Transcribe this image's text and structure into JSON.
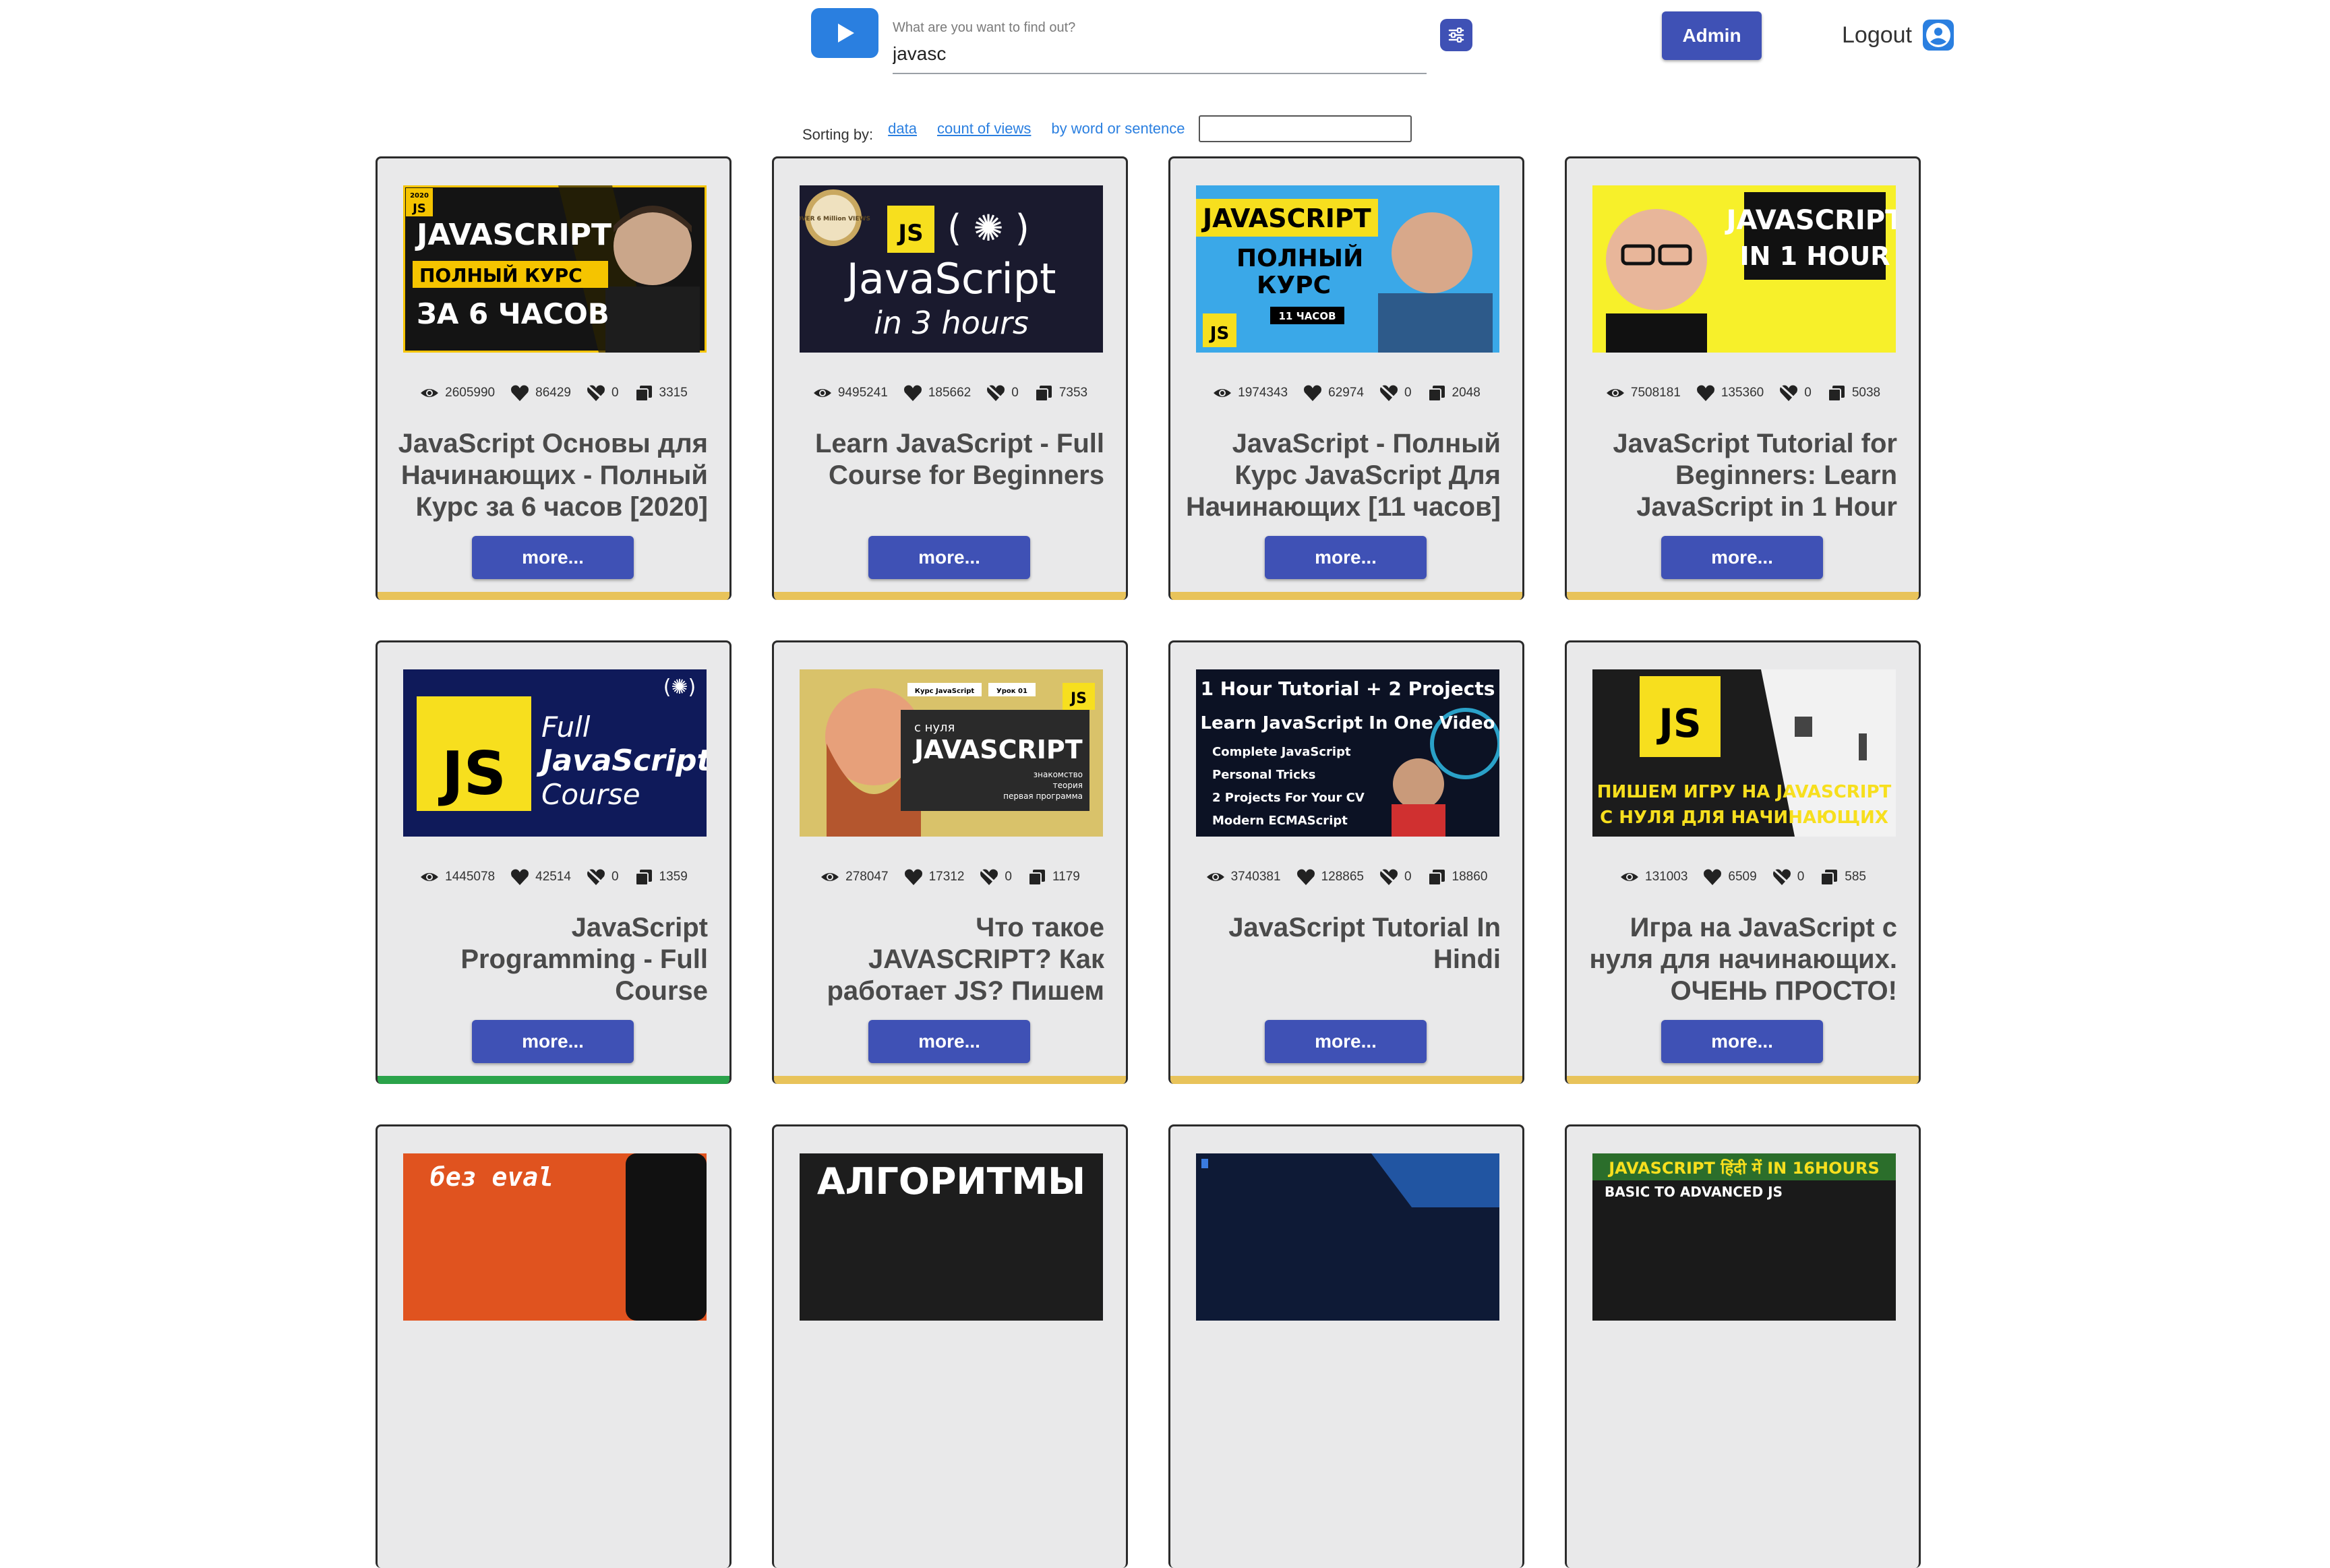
{
  "header": {
    "search_label": "What are you want to find out?",
    "search_value": "javasc",
    "admin_label": "Admin",
    "logout_label": "Logout"
  },
  "sorting": {
    "label": "Sorting by:",
    "options": [
      "data",
      "count of views",
      "by word or sentence"
    ],
    "word_input_value": ""
  },
  "colors": {
    "accent": "#3f51b5",
    "logo": "#2a7fe0",
    "bar_yellow": "#e8c35a",
    "bar_green": "#2aa34a"
  },
  "cards": [
    {
      "title": "JavaScript Основы для Начинающих - Полный Курс за 6 часов [2020]",
      "views": "2605990",
      "likes": "86429",
      "dislikes": "0",
      "comments": "3315",
      "more": "more...",
      "bar": "yellow",
      "thumb": {
        "lines": [
          "JAVASCRIPT",
          "ПОЛНЫЙ КУРС",
          "ЗА 6 ЧАСОВ"
        ],
        "badge": "JS",
        "year": "2020"
      }
    },
    {
      "title": "Learn JavaScript - Full Course for Beginners",
      "views": "9495241",
      "likes": "185662",
      "dislikes": "0",
      "comments": "7353",
      "more": "more...",
      "bar": "yellow",
      "thumb": {
        "lines": [
          "JavaScript",
          "in 3 hours"
        ],
        "badge": "JS",
        "seal": "OVER 6 Million VIEWS"
      }
    },
    {
      "title": "JavaScript - Полный Курс JavaScript Для Начинающих [11 часов]",
      "views": "1974343",
      "likes": "62974",
      "dislikes": "0",
      "comments": "2048",
      "more": "more...",
      "bar": "yellow",
      "thumb": {
        "lines": [
          "JAVASCRIPT",
          "ПОЛНЫЙ",
          "КУРС",
          "11 ЧАСОВ"
        ],
        "badge": "JS"
      }
    },
    {
      "title": "JavaScript Tutorial for Beginners: Learn JavaScript in 1 Hour",
      "views": "7508181",
      "likes": "135360",
      "dislikes": "0",
      "comments": "5038",
      "more": "more...",
      "bar": "yellow",
      "thumb": {
        "lines": [
          "JAVASCRIPT",
          "IN 1 HOUR"
        ]
      }
    },
    {
      "title": "JavaScript Programming - Full Course",
      "views": "1445078",
      "likes": "42514",
      "dislikes": "0",
      "comments": "1359",
      "more": "more...",
      "bar": "green",
      "thumb": {
        "lines": [
          "Full",
          "JavaScript",
          "Course"
        ],
        "badge": "JS"
      }
    },
    {
      "title": "Что такое JAVASCRIPT? Как работает JS? Пишем первую программу",
      "views": "278047",
      "likes": "17312",
      "dislikes": "0",
      "comments": "1179",
      "more": "more...",
      "bar": "yellow",
      "thumb": {
        "lines": [
          "с нуля",
          "JAVASCRIPT",
          "знакомство",
          "теория",
          "первая программа"
        ],
        "badge": "JS",
        "tags": [
          "Курс JavaScript",
          "Урок 01"
        ]
      }
    },
    {
      "title": "JavaScript Tutorial In Hindi",
      "views": "3740381",
      "likes": "128865",
      "dislikes": "0",
      "comments": "18860",
      "more": "more...",
      "bar": "yellow",
      "thumb": {
        "lines": [
          "1 Hour Tutorial + 2 Projects",
          "Learn JavaScript In One Video",
          "Complete JavaScript",
          "Personal Tricks",
          "2 Projects For Your CV",
          "Modern ECMAScript"
        ]
      }
    },
    {
      "title": "Игра на JavaScript с нуля для начинающих. ОЧЕНЬ ПРОСТО!",
      "views": "131003",
      "likes": "6509",
      "dislikes": "0",
      "comments": "585",
      "more": "more...",
      "bar": "yellow",
      "thumb": {
        "lines": [
          "ПИШЕМ ИГРУ НА JAVASCRIPT",
          "С НУЛЯ ДЛЯ НАЧИНАЮЩИХ"
        ],
        "badge": "JS"
      }
    },
    {
      "title": "",
      "views": "",
      "likes": "",
      "dislikes": "",
      "comments": "",
      "more": "",
      "bar": "yellow",
      "thumb": {
        "lines": [
          "без eval"
        ]
      }
    },
    {
      "title": "",
      "views": "",
      "likes": "",
      "dislikes": "",
      "comments": "",
      "more": "",
      "bar": "yellow",
      "thumb": {
        "lines": [
          "АЛГОРИТМЫ"
        ]
      }
    },
    {
      "title": "",
      "views": "",
      "likes": "",
      "dislikes": "",
      "comments": "",
      "more": "",
      "bar": "yellow",
      "thumb": {
        "lines": []
      }
    },
    {
      "title": "",
      "views": "",
      "likes": "",
      "dislikes": "",
      "comments": "",
      "more": "",
      "bar": "yellow",
      "thumb": {
        "lines": [
          "JAVASCRIPT हिंदी में IN 16HOURS",
          "BASIC TO ADVANCED JS"
        ]
      }
    }
  ]
}
